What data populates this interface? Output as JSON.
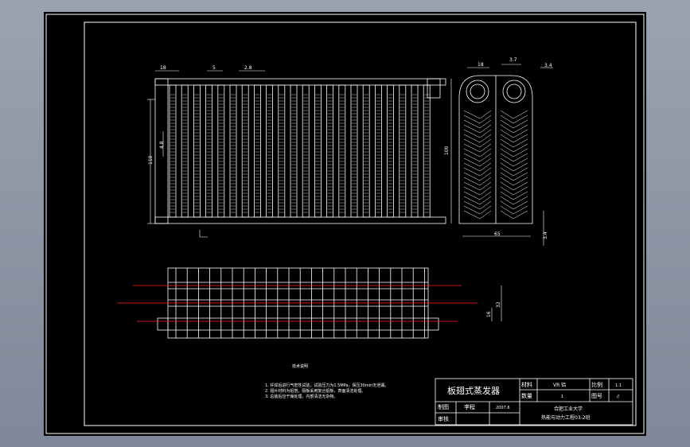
{
  "title_block": {
    "drawing_title": "板翅式蒸发器",
    "material_label": "材料",
    "material_value": "VR 铝",
    "scale_label": "比例",
    "scale_value": "1:1",
    "quantity_label": "数量",
    "quantity_value": "1",
    "drawing_no_label": "图号",
    "drawing_no_value": "//",
    "drawn_label": "制图",
    "drawn_name": "李程",
    "drawn_date": "2007.6",
    "checked_label": "审核",
    "school": "合肥工业大学",
    "class_info": "热能与动力工程03-2班"
  },
  "notes": {
    "heading": "技术说明",
    "line1": "1. 钎焊后进行气密性试验，试验压力为1.5MPa，保压30min无泄漏。",
    "line2": "2. 翅片材料为铝箔，隔板采用复合铝板，表面清洁处理。",
    "line3": "3. 总装后应干燥处理，内部清洁无杂物。"
  },
  "dimensions": {
    "front_top_left": "18",
    "front_top_mid": "5",
    "front_top_right": "2.8",
    "front_height_outer": "110",
    "front_height_inner": "4.8",
    "side_top_left": "18",
    "side_top_right": "3.7",
    "side_top_far": "3.4",
    "side_height": "100",
    "side_width": "65",
    "side_bottom_right": "3.4",
    "plan_spacing_inner": "16",
    "plan_spacing_outer": "32"
  },
  "colors": {
    "line": "#ffffff",
    "pipe": "#ff2020",
    "background": "#000000",
    "app_background": "#8b95a5"
  }
}
